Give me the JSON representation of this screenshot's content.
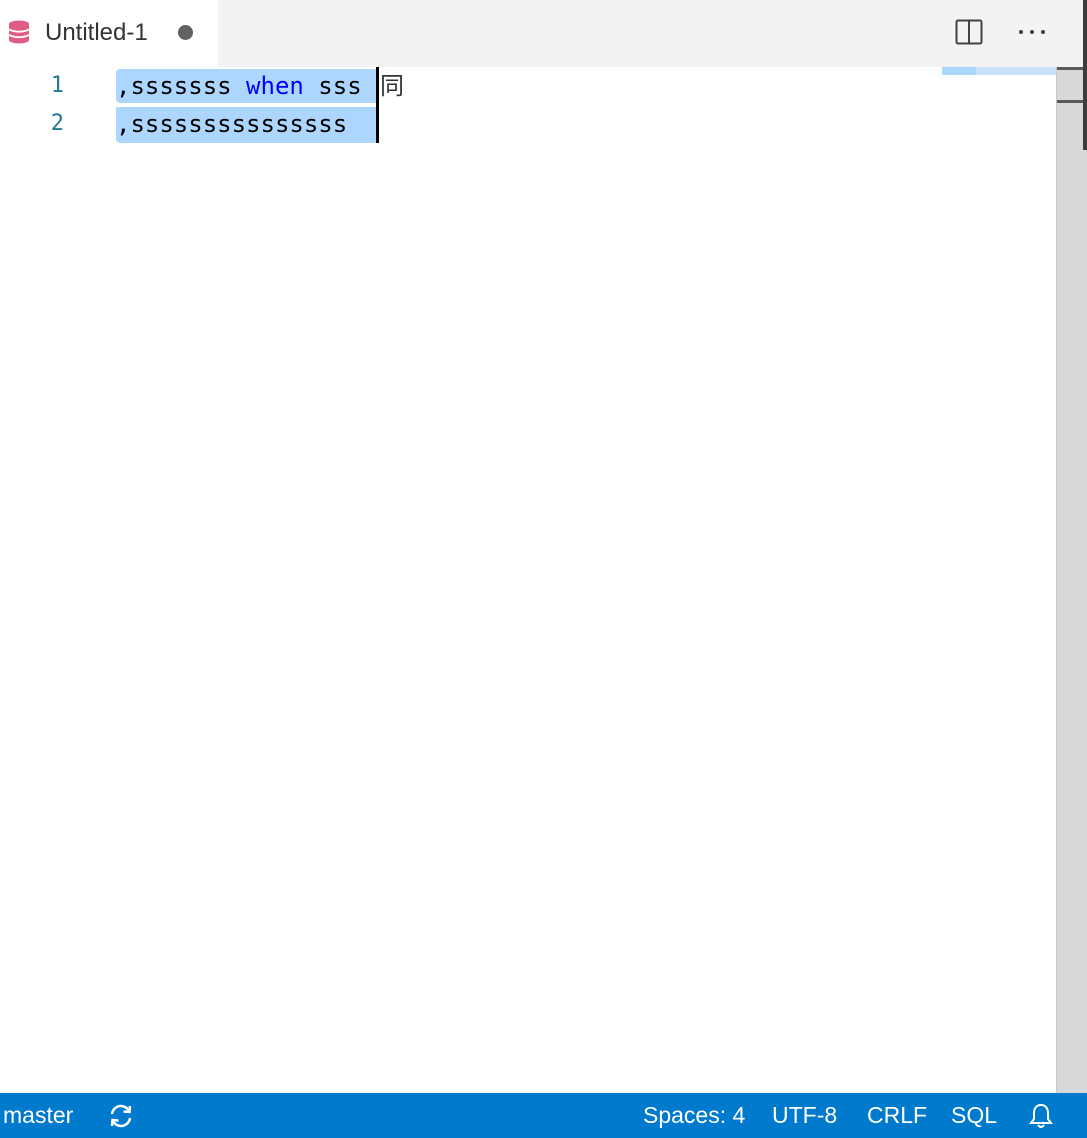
{
  "tab": {
    "icon": "database-icon",
    "title": "Untitled-1",
    "dirty": true,
    "icon_color": "#e05c82"
  },
  "toolbar": {
    "split_icon": "split-editor-icon",
    "more_icon": "more-actions-icon"
  },
  "editor": {
    "lines": [
      {
        "number": "1",
        "tokens": [
          {
            "text": ",sssssss ",
            "kind": "plain"
          },
          {
            "text": "when",
            "kind": "keyword"
          },
          {
            "text": " sss",
            "kind": "plain"
          }
        ],
        "ime_composition": "同"
      },
      {
        "number": "2",
        "tokens": [
          {
            "text": ",sssssssssssssss",
            "kind": "plain"
          }
        ]
      }
    ],
    "selection_color": "#add6ff",
    "keyword_color": "#0000ff",
    "line_number_color": "#237893"
  },
  "statusbar": {
    "branch": "master",
    "sync_icon": "sync-icon",
    "indentation": "Spaces: 4",
    "encoding": "UTF-8",
    "eol": "CRLF",
    "language": "SQL",
    "bell_icon": "bell-icon",
    "background": "#007acc"
  }
}
